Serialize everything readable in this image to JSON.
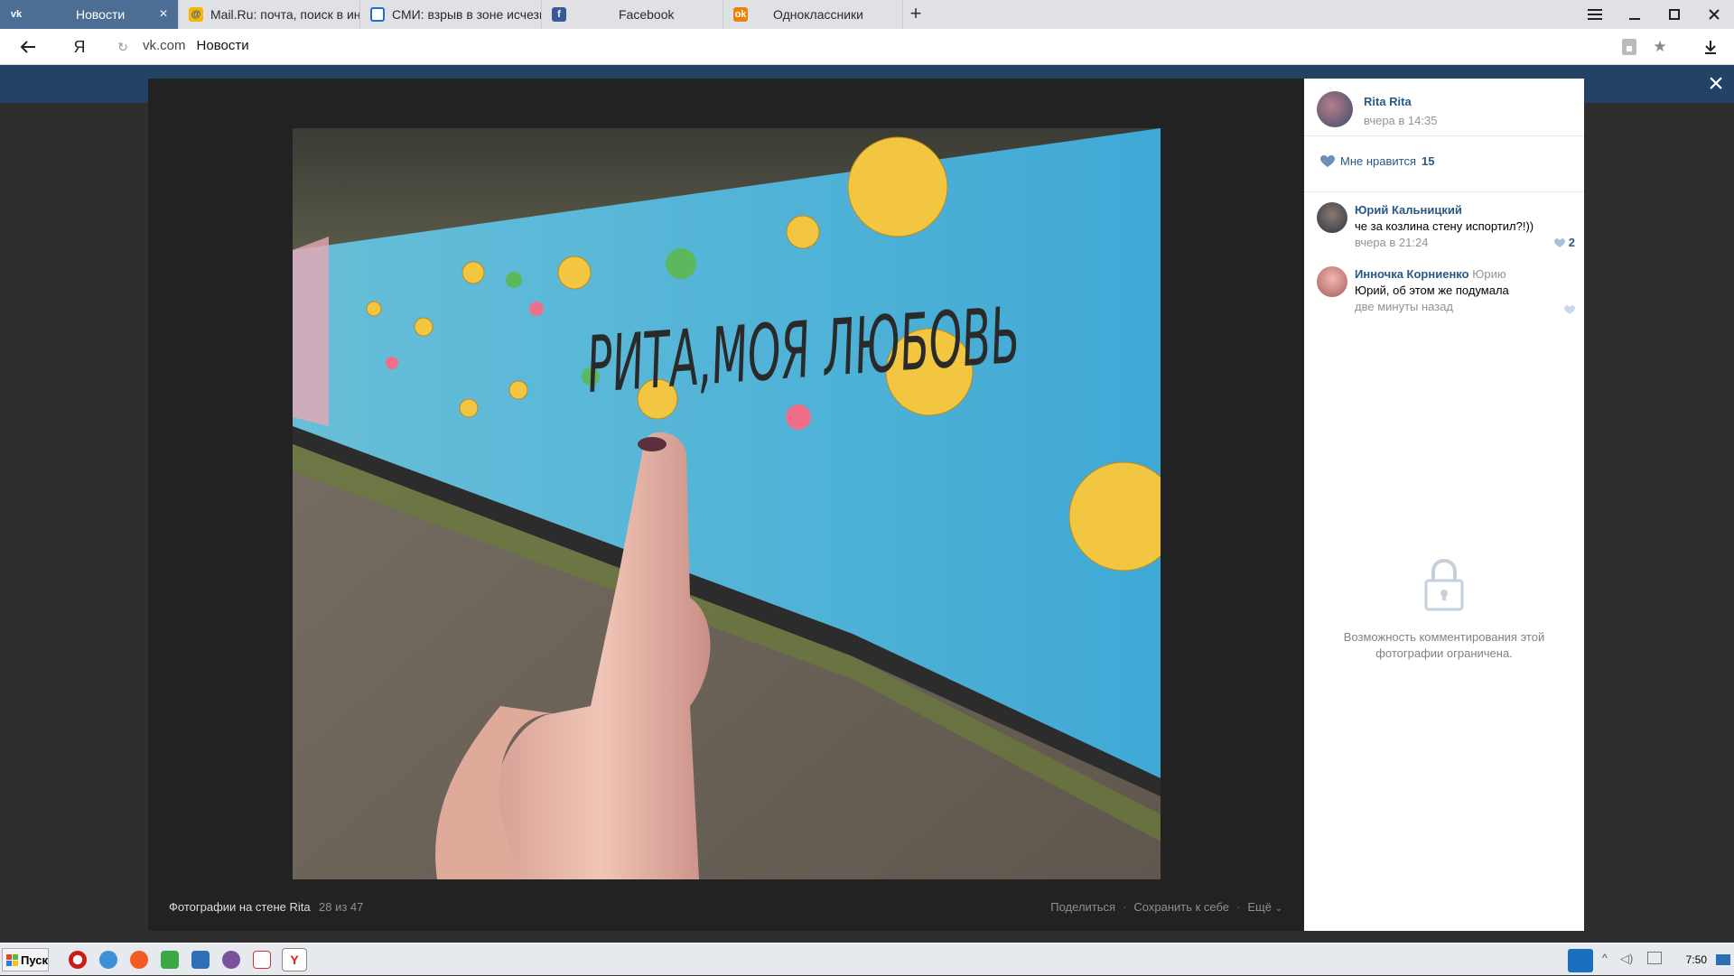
{
  "browser": {
    "tabs": [
      {
        "title": "Новости",
        "favicon": "vk-icon",
        "active": true
      },
      {
        "title": "Mail.Ru: почта, поиск в инте",
        "favicon": "mailru-icon",
        "active": false
      },
      {
        "title": "СМИ: взрыв в зоне исчезн",
        "favicon": "news-icon",
        "active": false
      },
      {
        "title": "Facebook",
        "favicon": "facebook-icon",
        "active": false
      },
      {
        "title": "Одноклассники",
        "favicon": "odnoklassniki-icon",
        "active": false
      }
    ],
    "address": {
      "domain": "vk.com",
      "page_title": "Новости"
    }
  },
  "viewer": {
    "album_label": "Фотографии на стене Rita",
    "counter": "28 из 47",
    "actions": {
      "share": "Поделиться",
      "save": "Сохранить к себе",
      "more": "Ещё"
    }
  },
  "sidebar": {
    "owner_name": "Rita Rita",
    "post_time": "вчера в 14:35",
    "likes_label": "Мне нравится",
    "likes_count": "15",
    "comments": [
      {
        "author": "Юрий Кальницкий",
        "reply_to": "",
        "text": "че за козлина стену испортил?!))",
        "date": "вчера в 21:24",
        "likes": "2"
      },
      {
        "author": "Инночка Корниенко",
        "reply_to": "Юрию",
        "text": "Юрий, об этом же подумала",
        "date": "две минуты назад",
        "likes": ""
      }
    ],
    "restricted_text": "Возможность комментирования этой фотографии ограничена."
  },
  "taskbar": {
    "start_label": "Пуск",
    "clock": "7:50"
  },
  "colors": {
    "vk_blue": "#4d6e94",
    "link": "#2a5885",
    "viewer_bg": "#222222"
  }
}
